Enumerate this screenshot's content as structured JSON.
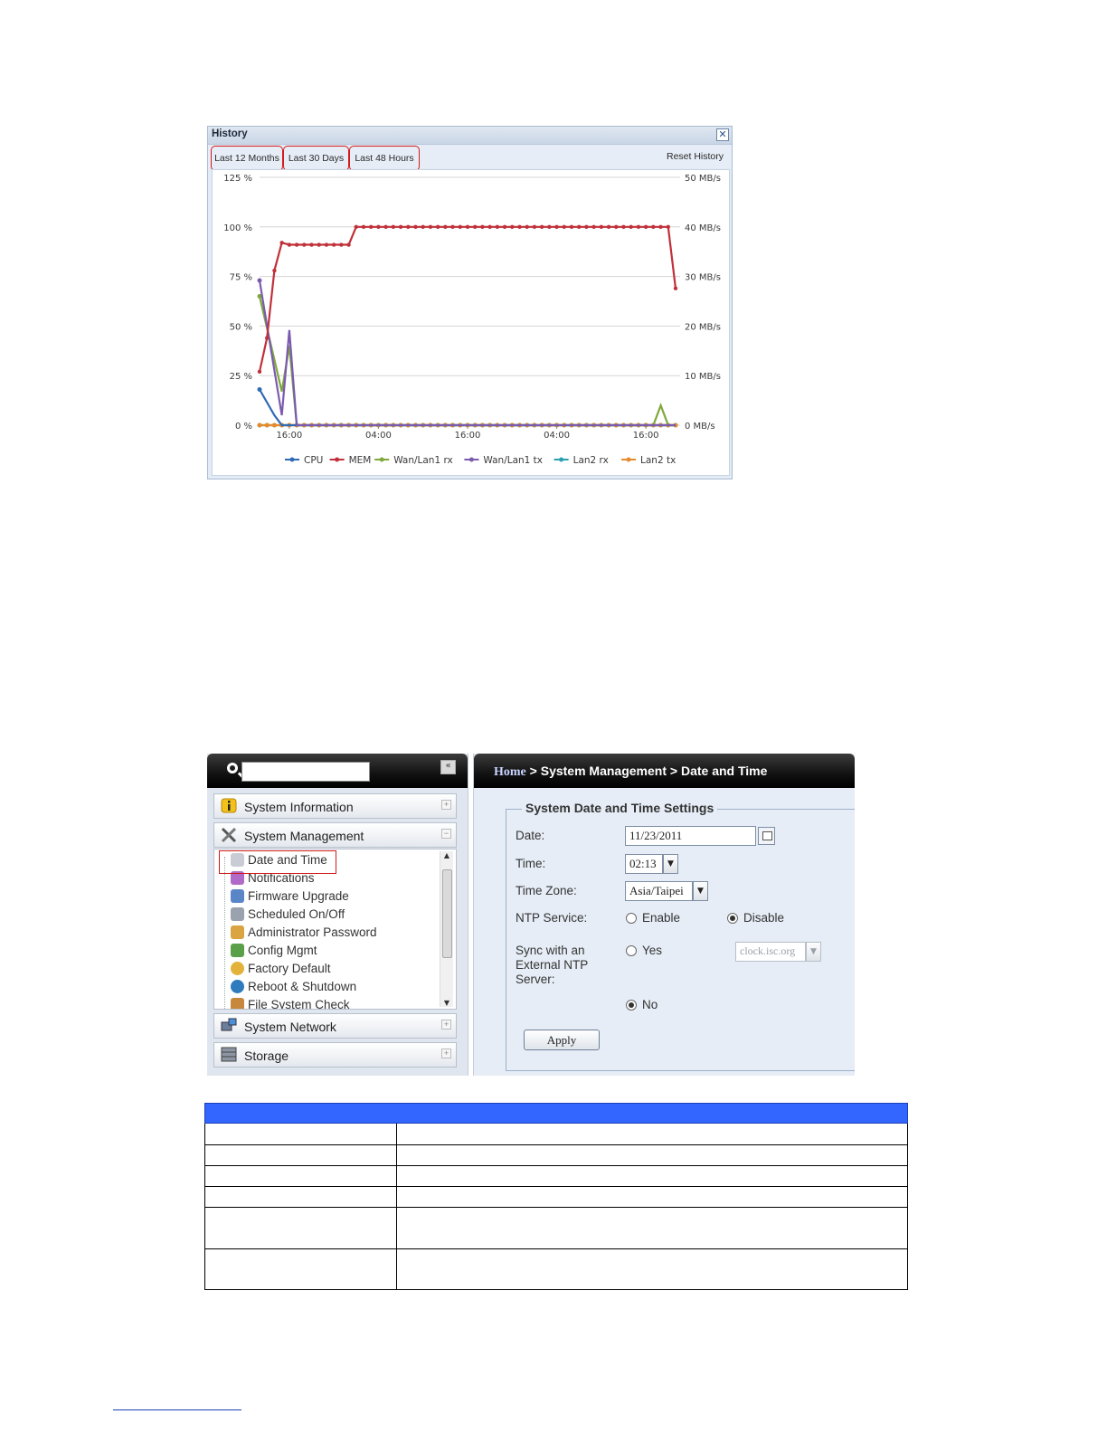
{
  "history": {
    "title": "History",
    "close": "✕",
    "tabs": [
      "Last 12 Months",
      "Last 30 Days",
      "Last 48 Hours"
    ],
    "reset": "Reset History"
  },
  "chart_data": {
    "type": "line",
    "y_left_ticks": [
      "125 %",
      "100 %",
      "75 %",
      "50 %",
      "25 %",
      "0 %"
    ],
    "y_right_ticks": [
      "50 MB/s",
      "40 MB/s",
      "30 MB/s",
      "20 MB/s",
      "10 MB/s",
      "0 MB/s"
    ],
    "ylim_left": [
      0,
      125
    ],
    "ylim_right": [
      0,
      50
    ],
    "x_ticks": [
      "16:00",
      "04:00",
      "16:00",
      "04:00",
      "16:00"
    ],
    "x_tick_index": [
      4,
      16,
      28,
      40,
      52
    ],
    "n_points": 57,
    "grid": true,
    "legend_position": "bottom",
    "series": [
      {
        "name": "CPU",
        "color": "#2f6ab5",
        "sparse": [
          [
            0,
            18
          ],
          [
            2,
            5
          ],
          [
            3,
            0
          ],
          [
            56,
            0
          ]
        ]
      },
      {
        "name": "MEM",
        "color": "#c0313a",
        "values": [
          27,
          44,
          78,
          92,
          91,
          91,
          91,
          91,
          91,
          91,
          91,
          91,
          91,
          100,
          100,
          100,
          100,
          100,
          100,
          100,
          100,
          100,
          100,
          100,
          100,
          100,
          100,
          100,
          100,
          100,
          100,
          100,
          100,
          100,
          100,
          100,
          100,
          100,
          100,
          100,
          100,
          100,
          100,
          100,
          100,
          100,
          100,
          100,
          100,
          100,
          100,
          100,
          100,
          100,
          100,
          100,
          69
        ]
      },
      {
        "name": "Wan/Lan1 rx",
        "color": "#7fa83c",
        "sparse": [
          [
            0,
            65
          ],
          [
            3,
            17
          ],
          [
            4,
            40
          ],
          [
            5,
            0
          ],
          [
            53,
            0
          ],
          [
            54,
            10
          ],
          [
            55,
            0
          ],
          [
            56,
            0
          ]
        ]
      },
      {
        "name": "Wan/Lan1 tx",
        "color": "#7a5bb0",
        "sparse": [
          [
            0,
            73
          ],
          [
            3,
            5
          ],
          [
            4,
            48
          ],
          [
            5,
            0
          ],
          [
            56,
            0
          ]
        ]
      },
      {
        "name": "Lan2 rx",
        "color": "#2aa0b0",
        "sparse": [
          [
            0,
            0
          ],
          [
            56,
            0
          ]
        ]
      },
      {
        "name": "Lan2 tx",
        "color": "#e68a2e",
        "sparse": [
          [
            0,
            0
          ],
          [
            56,
            0
          ]
        ]
      }
    ]
  },
  "admin": {
    "search": {
      "placeholder": ""
    },
    "collapse": "«",
    "sections": {
      "system_information": "System Information",
      "system_management": "System Management",
      "system_network": "System Network",
      "storage": "Storage"
    },
    "submenu": [
      "Date and Time",
      "Notifications",
      "Firmware Upgrade",
      "Scheduled On/Off",
      "Administrator Password",
      "Config Mgmt",
      "Factory Default",
      "Reboot & Shutdown",
      "File System Check"
    ],
    "breadcrumb": {
      "home": "Home",
      "sep1": " > ",
      "section": "System Management",
      "sep2": " > ",
      "page": "Date and Time"
    },
    "form": {
      "legend": "System Date and Time Settings",
      "date_label": "Date:",
      "date_value": "11/23/2011",
      "time_label": "Time:",
      "time_value": "02:13",
      "tz_label": "Time Zone:",
      "tz_value": "Asia/Taipei",
      "ntp_label": "NTP Service:",
      "ntp_enable": "Enable",
      "ntp_disable": "Disable",
      "sync_label": "Sync with an External NTP Server:",
      "sync_yes": "Yes",
      "sync_no": "No",
      "ntp_server_value": "clock.isc.org",
      "apply": "Apply"
    }
  }
}
